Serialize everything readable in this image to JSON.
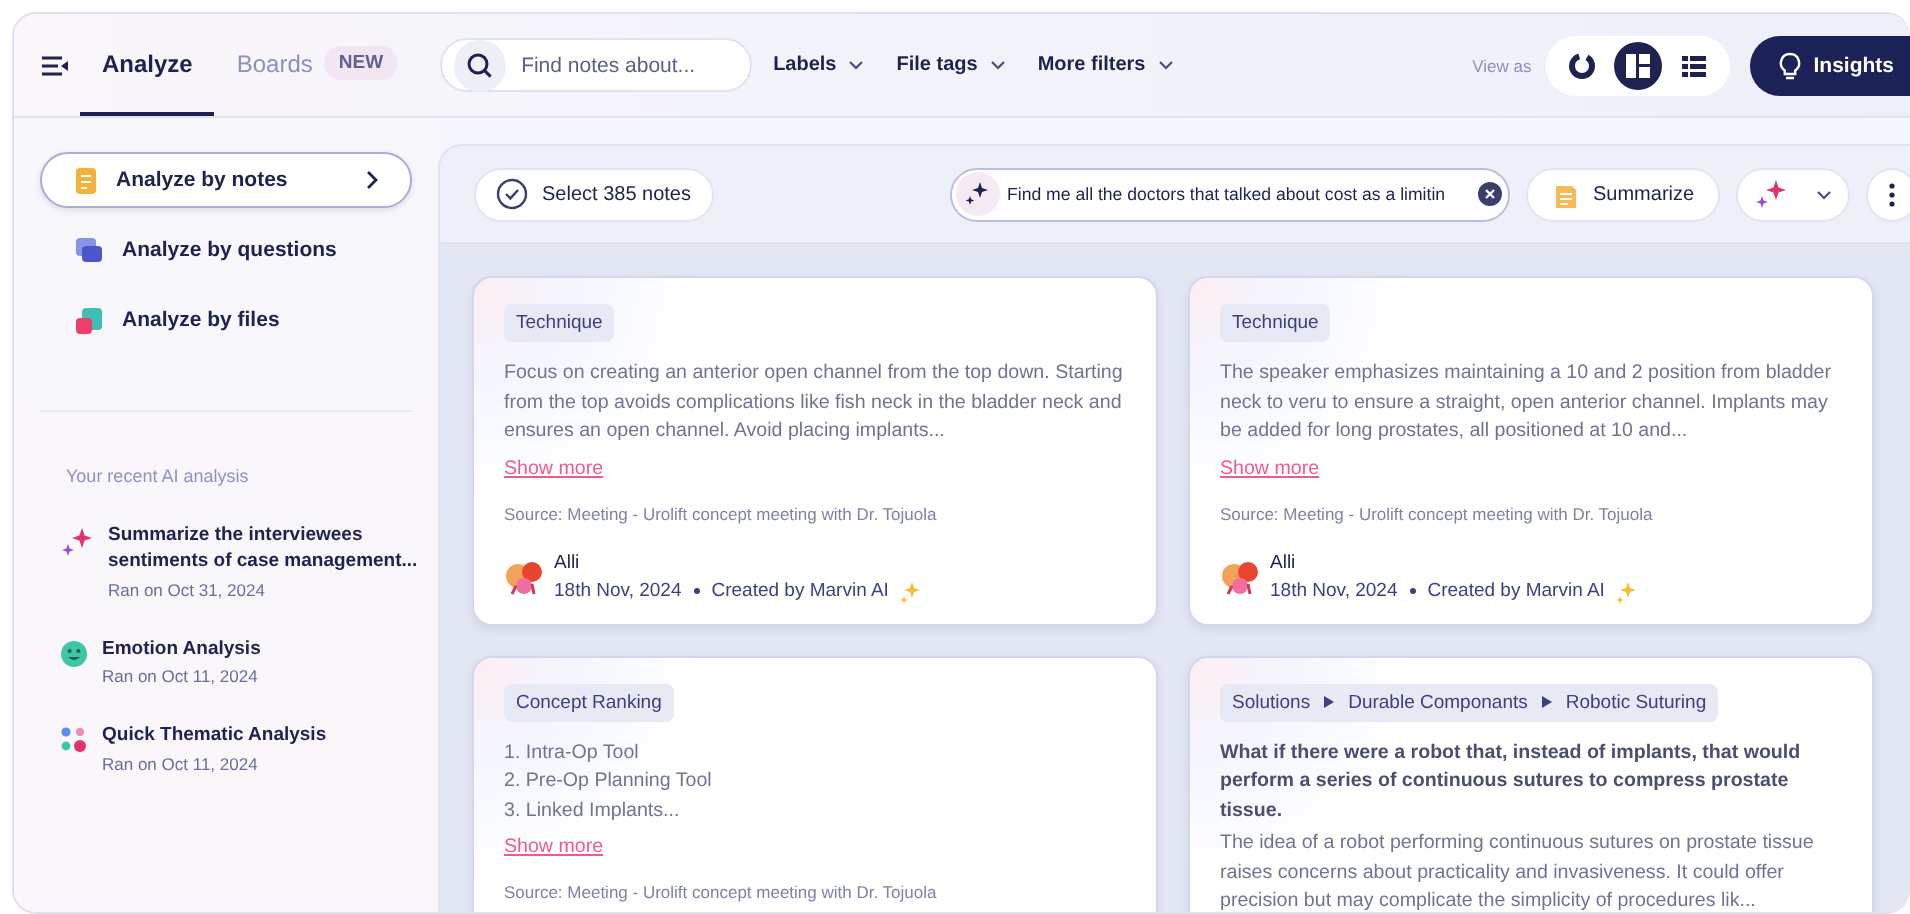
{
  "topbar": {
    "tabs": [
      {
        "label": "Analyze",
        "selected": true
      },
      {
        "label": "Boards",
        "badge": "NEW",
        "selected": false
      }
    ],
    "search": {
      "placeholder": "Find notes about..."
    },
    "filters": [
      "Labels",
      "File tags",
      "More filters"
    ],
    "view_as": {
      "label": "View as",
      "options": [
        {
          "kind": "chart",
          "selected": false
        },
        {
          "kind": "grid",
          "selected": true
        },
        {
          "kind": "list",
          "selected": false
        }
      ]
    },
    "insights_button": "Insights"
  },
  "sidebar": {
    "modes": [
      {
        "kind": "notes",
        "label": "Analyze by notes",
        "selected": true
      },
      {
        "kind": "questions",
        "label": "Analyze by questions",
        "selected": false
      },
      {
        "kind": "files",
        "label": "Analyze by files",
        "selected": false
      }
    ],
    "recent_title": "Your recent AI analysis",
    "recent": [
      {
        "kind": "sparkle",
        "title": "Summarize the interviewees sentiments of case management...",
        "date": "Ran on Oct 31, 2024"
      },
      {
        "kind": "emotion",
        "title": "Emotion Analysis",
        "date": "Ran on Oct 11, 2024"
      },
      {
        "kind": "thematic",
        "title": "Quick Thematic Analysis",
        "date": "Ran on Oct 11, 2024"
      }
    ]
  },
  "toolbar": {
    "select_button": "Select 385 notes",
    "ai_query": {
      "value": "Find me all the doctors that talked about cost as a limitin"
    },
    "summarize_button": "Summarize"
  },
  "cards": [
    {
      "tags": [
        "Technique"
      ],
      "body": "Focus on creating an anterior open channel from the top down. Starting from the top avoids complications like fish neck in the bladder neck and ensures an open channel. Avoid placing implants...",
      "show_more": "Show more",
      "source": "Source: Meeting - Urolift concept meeting with Dr. Tojuola",
      "author": "Alli",
      "date": "18th Nov, 2024",
      "created_by": "Created by Marvin AI"
    },
    {
      "tags": [
        "Technique"
      ],
      "body": "The speaker emphasizes maintaining a 10 and 2 position from bladder neck to veru to ensure a straight, open anterior channel. Implants may be added for long prostates, all positioned at 10 and...",
      "show_more": "Show more",
      "source": "Source: Meeting - Urolift concept meeting with Dr. Tojuola",
      "author": "Alli",
      "date": "18th Nov, 2024",
      "created_by": "Created by Marvin AI"
    },
    {
      "tags": [
        "Concept Ranking"
      ],
      "list": [
        "1. Intra-Op Tool",
        "2. Pre-Op Planning Tool",
        "3. Linked Implants..."
      ],
      "show_more": "Show more",
      "source": "Source: Meeting - Urolift concept meeting with Dr. Tojuola"
    },
    {
      "tags": [
        "Solutions",
        "Durable Componants",
        "Robotic Suturing"
      ],
      "lead": "What if there were a robot that, instead of implants, that would perform a series of continuous sutures to compress prostate tissue.",
      "body": "The idea of a robot performing continuous sutures on prostate tissue raises concerns about practicality and invasiveness. It could offer precision but may complicate the simplicity of procedures lik..."
    }
  ]
}
